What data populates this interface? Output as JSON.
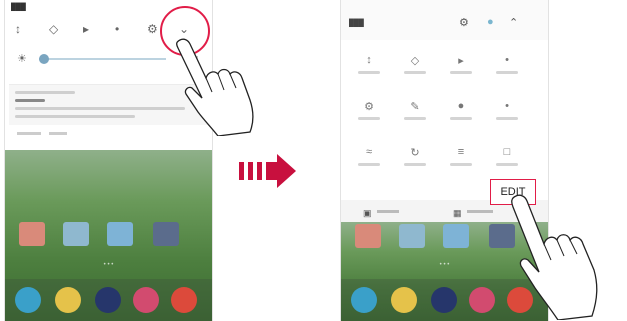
{
  "panel_left": {
    "name": "quick-settings-panel",
    "highlighted_control": "expand-arrow"
  },
  "panel_right": {
    "name": "expanded-quick-settings-panel",
    "edit_label": "EDIT"
  },
  "colors": {
    "highlight": "#e11d48",
    "arrow": "#c8103e",
    "wallpaper": "#4d7f3f"
  },
  "icons": {
    "transition_arrow": "right-arrow-icon",
    "pointer": "hand-pointer-icon"
  }
}
